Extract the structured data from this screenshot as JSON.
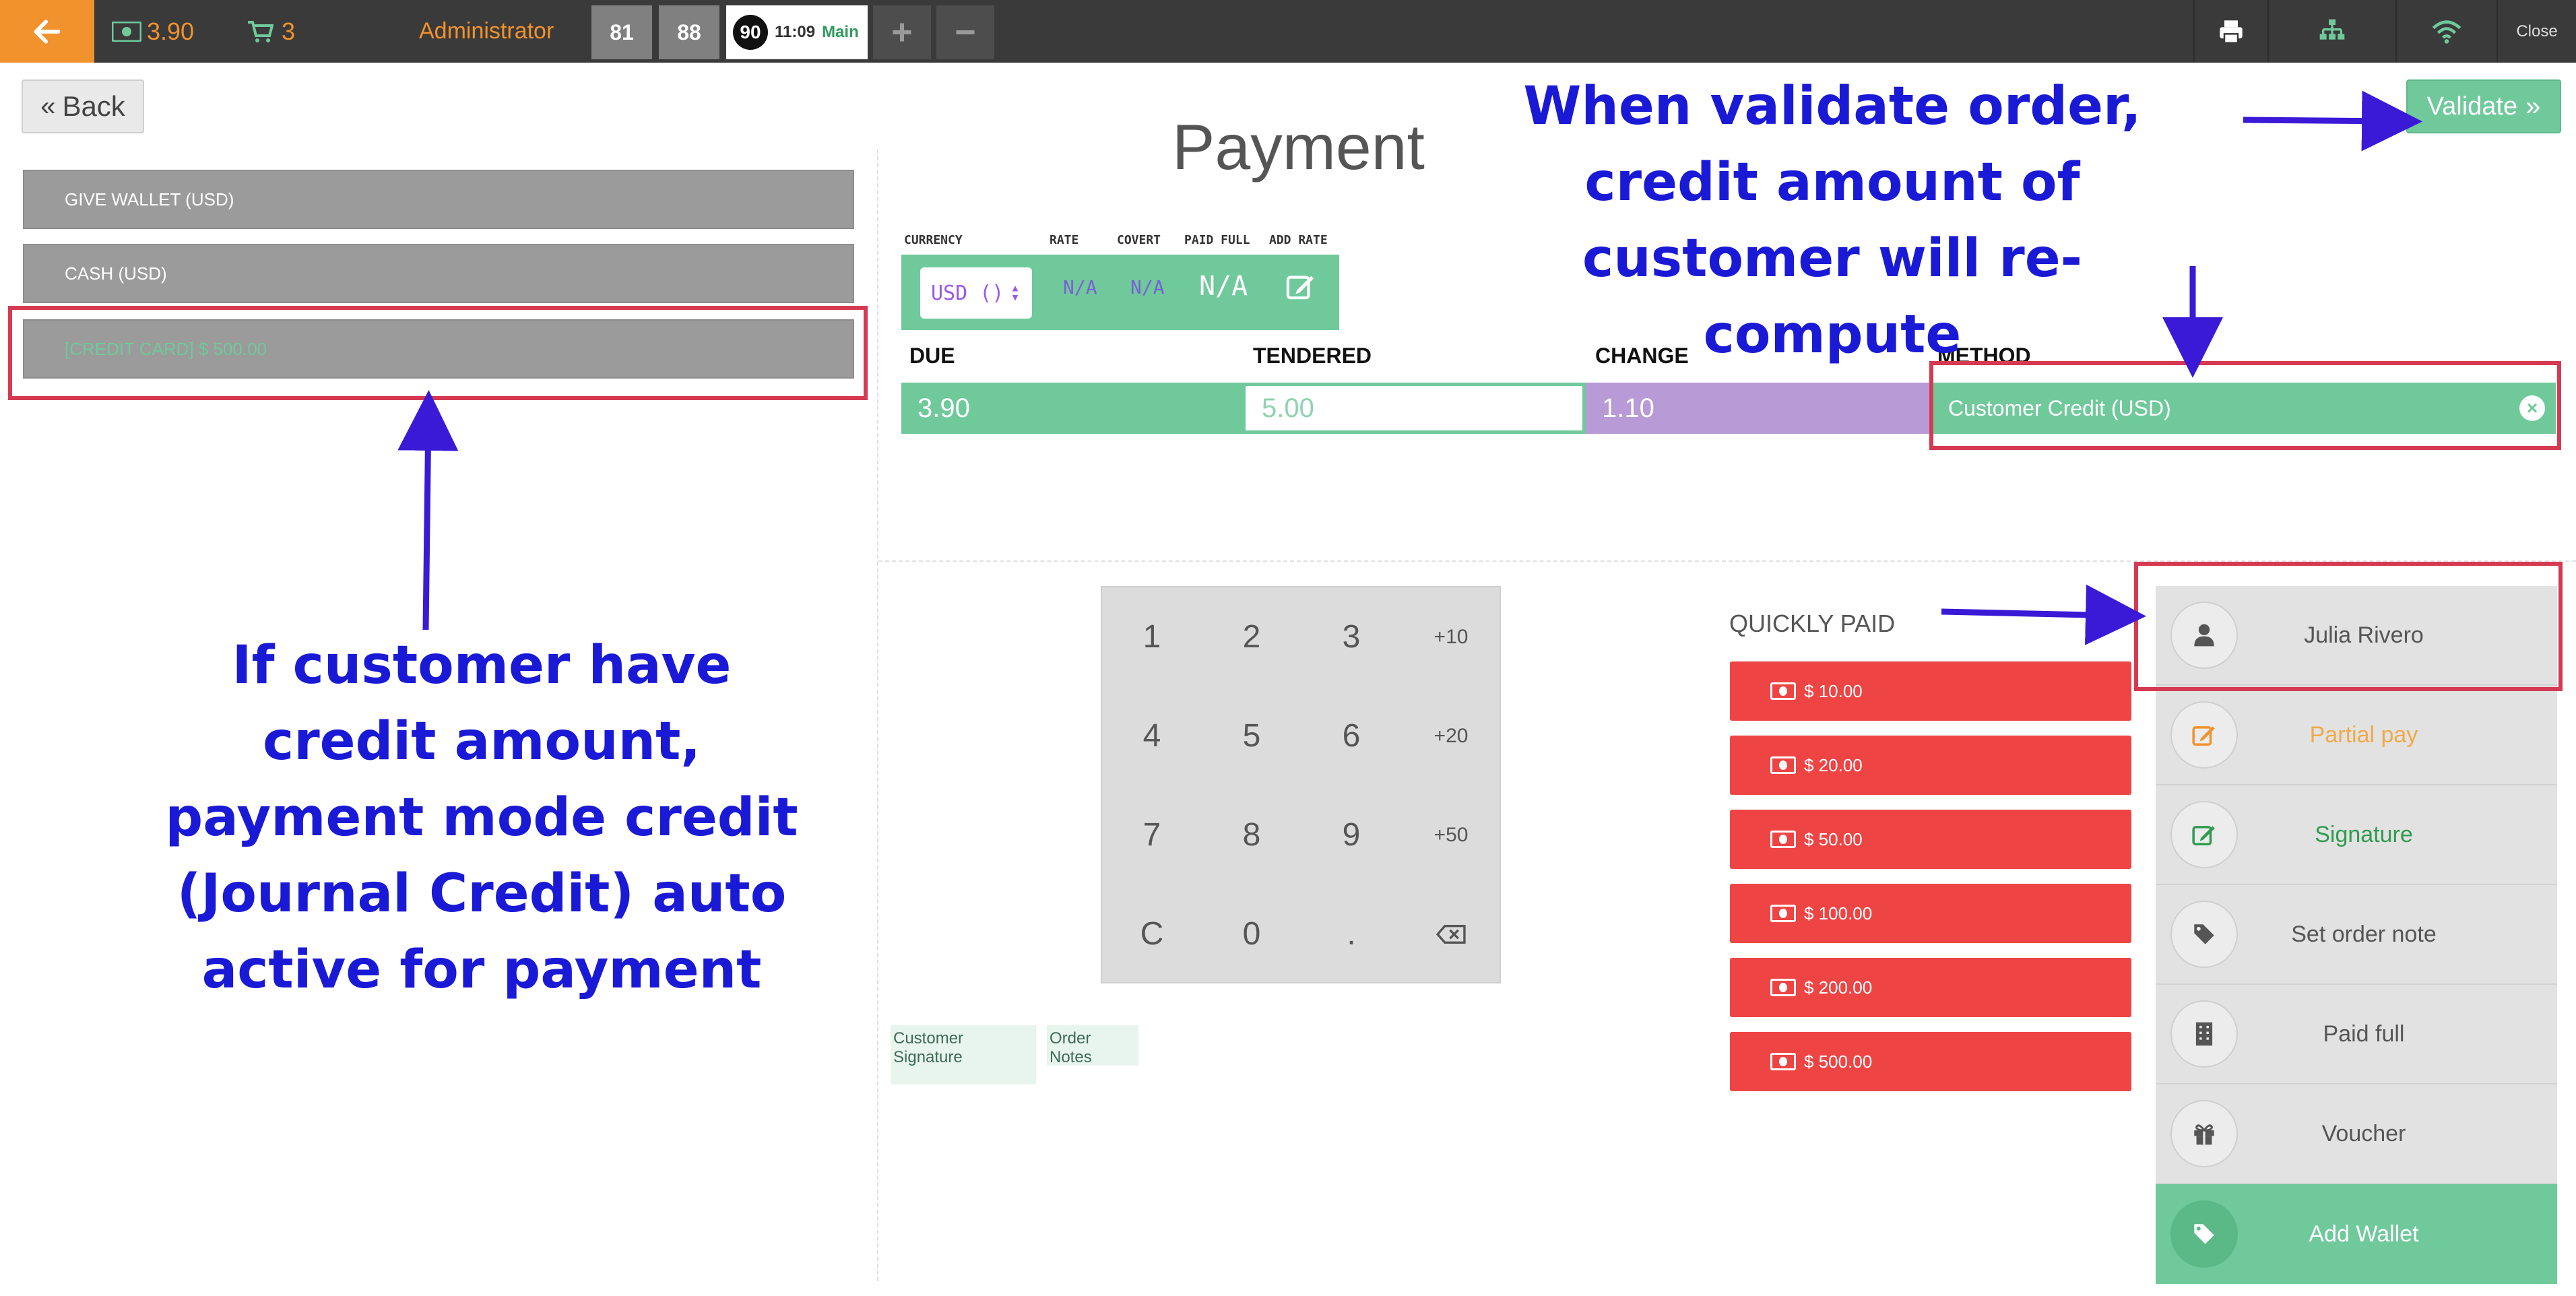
{
  "topbar": {
    "amount": "3.90",
    "cart_count": "3",
    "user": "Administrator",
    "order_tabs": [
      "81",
      "88"
    ],
    "active_order": {
      "number": "90",
      "time": "11:09",
      "label": "Main"
    },
    "close_label": "Close"
  },
  "nav": {
    "back_label": "Back",
    "validate_label": "Validate"
  },
  "title": "Payment",
  "payment_methods": [
    "GIVE WALLET (USD)",
    "CASH (USD)",
    "[CREDIT CARD] $ 500.00"
  ],
  "currency": {
    "headers": [
      "CURRENCY",
      "RATE",
      "COVERT",
      "PAID FULL",
      "ADD RATE"
    ],
    "selected": "USD ()",
    "rate": "N/A",
    "covert": "N/A",
    "paid_full": "N/A"
  },
  "summary": {
    "headers": {
      "due": "DUE",
      "tendered": "TENDERED",
      "change": "CHANGE",
      "method": "METHOD"
    },
    "due": "3.90",
    "tendered": "5.00",
    "change": "1.10",
    "method": "Customer Credit (USD)"
  },
  "numpad": [
    "1",
    "2",
    "3",
    "+10",
    "4",
    "5",
    "6",
    "+20",
    "7",
    "8",
    "9",
    "+50",
    "C",
    "0",
    "."
  ],
  "tags": {
    "signature": "Customer Signature",
    "notes": "Order Notes"
  },
  "quickly_paid": {
    "title": "QUICKLY PAID",
    "amounts": [
      "$ 10.00",
      "$ 20.00",
      "$ 50.00",
      "$ 100.00",
      "$ 200.00",
      "$ 500.00"
    ]
  },
  "actions": [
    {
      "label": "Julia Rivero",
      "icon": "user-icon"
    },
    {
      "label": "Partial pay",
      "icon": "edit-icon"
    },
    {
      "label": "Signature",
      "icon": "edit-icon"
    },
    {
      "label": "Set order note",
      "icon": "tag-icon"
    },
    {
      "label": "Paid full",
      "icon": "building-icon"
    },
    {
      "label": "Voucher",
      "icon": "gift-icon"
    },
    {
      "label": "Add Wallet",
      "icon": "tag-icon"
    }
  ],
  "annotations": {
    "left": [
      "If customer have",
      "credit amount,",
      "payment mode credit",
      "(Journal Credit) auto",
      "active for payment"
    ],
    "top": [
      "When validate order,",
      "credit amount of",
      "customer will re-compute"
    ]
  },
  "colors": {
    "green": "#6fc99b",
    "orange": "#f1922d",
    "red": "#ee4444",
    "purple": "#b89ad6",
    "annotation_blue": "#1a1ad6",
    "annotation_red": "#d63a52"
  }
}
